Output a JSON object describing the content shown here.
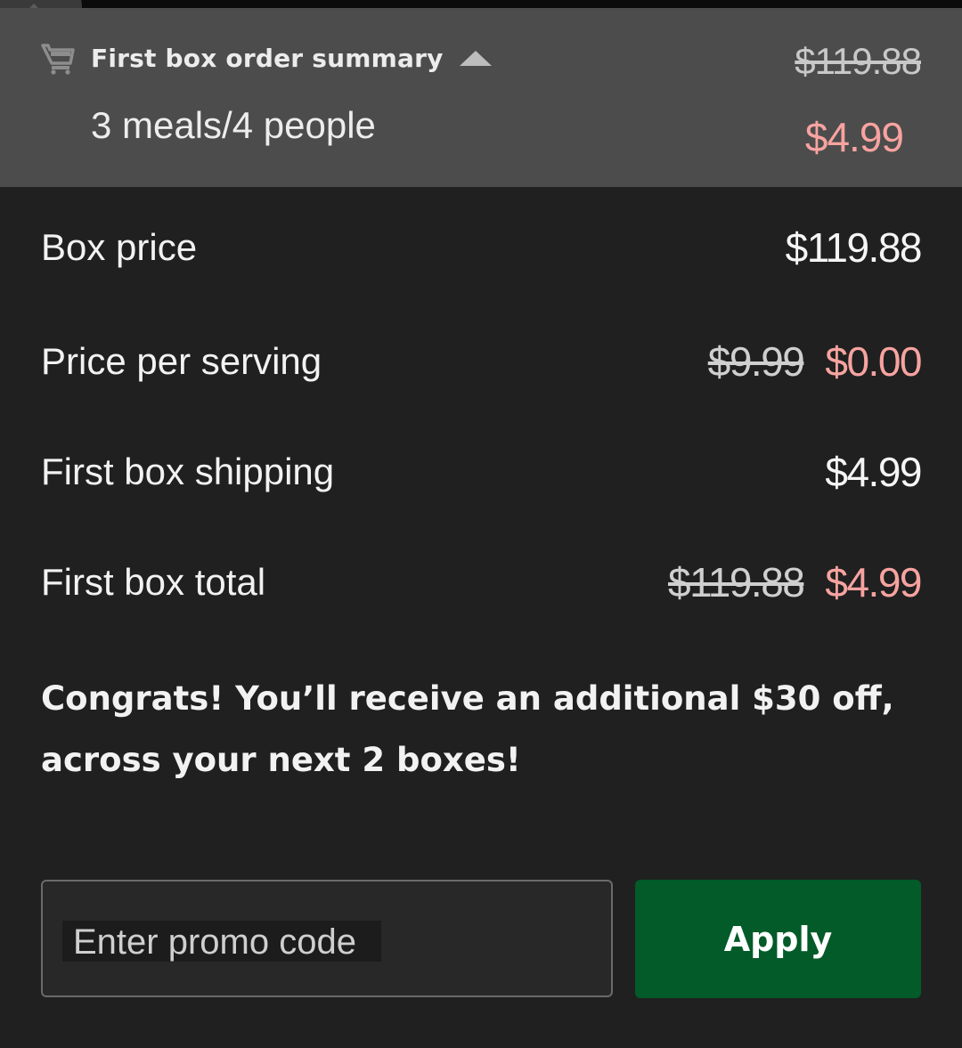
{
  "summary": {
    "title": "First box order summary",
    "plan": "3 meals/4 people",
    "original_total": "$119.88",
    "discounted_total": "$4.99"
  },
  "rows": [
    {
      "label": "Box price",
      "value": "$119.88"
    },
    {
      "label": "Price per serving",
      "old_value": "$9.99",
      "value": "$0.00"
    },
    {
      "label": "First box shipping",
      "value": "$4.99"
    },
    {
      "label": "First box total",
      "old_value": "$119.88",
      "value": "$4.99"
    }
  ],
  "congrats": "Congrats! You’ll receive an additional $30 off, across your next 2 boxes!",
  "promo": {
    "placeholder": "Enter promo code",
    "value": ""
  },
  "apply_label": "Apply",
  "colors": {
    "summary_bg": "#4c4c4c",
    "page_bg": "#202020",
    "discount_pink": "#f7a3a0",
    "apply_green": "#025b28"
  },
  "icons": {
    "cart": "cart-icon",
    "caret": "caret-up-icon",
    "edit": "pencil-icon"
  }
}
